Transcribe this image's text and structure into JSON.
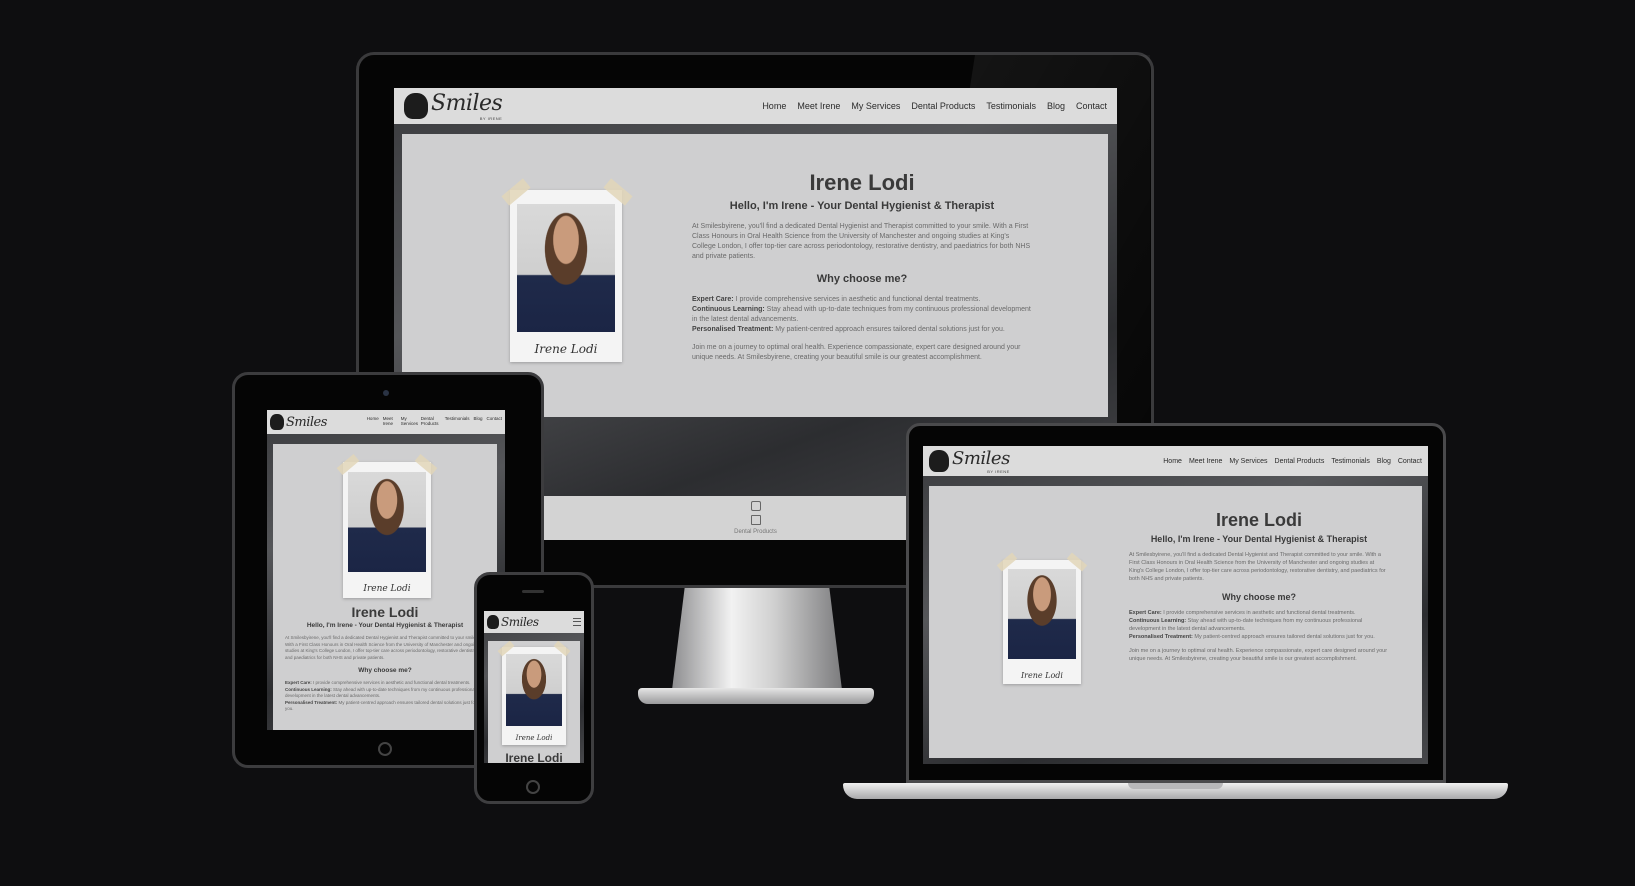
{
  "brand": {
    "name": "Smiles",
    "sub": "BY IRENE"
  },
  "nav": {
    "items": [
      "Home",
      "Meet Irene",
      "My Services",
      "Dental Products",
      "Testimonials",
      "Blog",
      "Contact"
    ],
    "tablet_items": [
      "Home",
      "Meet Irene",
      "My Services",
      "Dental Products",
      "Testimonials",
      "Blog",
      "Contact"
    ]
  },
  "hero": {
    "title": "Irene Lodi",
    "subtitle": "Hello, I'm Irene - Your Dental Hygienist & Therapist",
    "intro": "At Smilesbyirene, you'll find a dedicated Dental Hygienist and Therapist committed to your smile. With a First Class Honours in Oral Health Science from the University of Manchester and ongoing studies at King's College London, I offer top-tier care across periodontology, restorative dentistry, and paediatrics for both NHS and private patients.",
    "why_title": "Why choose me?",
    "points": [
      {
        "label": "Expert Care:",
        "text": " I provide comprehensive services in aesthetic and functional dental treatments."
      },
      {
        "label": "Continuous Learning:",
        "text": " Stay ahead with up-to-date techniques from my continuous professional development in the latest dental advancements."
      },
      {
        "label": "Personalised Treatment:",
        "text": " My patient-centred approach ensures tailored dental solutions just for you."
      }
    ],
    "closing": "Join me on a journey to optimal oral health. Experience compassionate, expert care designed around your unique needs. At Smilesbyirene, creating your beautiful smile is our greatest accomplishment.",
    "signature": "Irene Lodi"
  },
  "footer": {
    "link": "Dental Products"
  },
  "icons": {
    "instagram": "instagram-icon",
    "linkedin": "linkedin-icon",
    "menu": "hamburger-menu-icon"
  }
}
